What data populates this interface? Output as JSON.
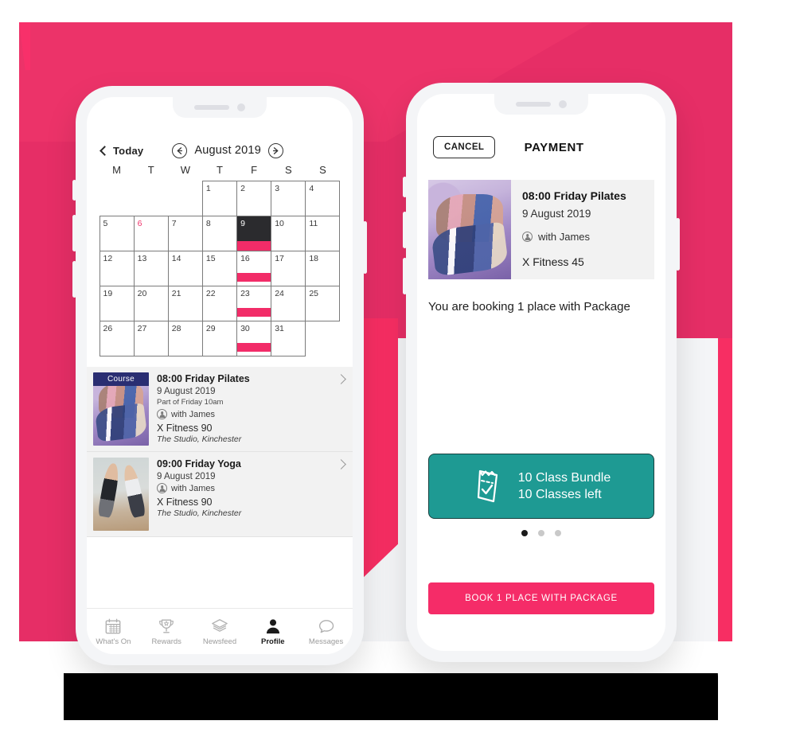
{
  "colors": {
    "pink": "#E62E66",
    "pink_bright": "#F72E63",
    "accent_pink": "#F22C68",
    "teal": "#1E9A93",
    "badge_navy": "#2A2E72",
    "selected_dark": "#2B2B2E"
  },
  "left_phone": {
    "header": {
      "back_label": "Today",
      "prev_icon": "arrow-left-circle-icon",
      "month_label": "August 2019",
      "next_icon": "arrow-right-circle-icon"
    },
    "calendar": {
      "day_headers": [
        "M",
        "T",
        "W",
        "T",
        "F",
        "S",
        "S"
      ],
      "leading_blanks": 3,
      "days": [
        {
          "n": 1
        },
        {
          "n": 2
        },
        {
          "n": 3
        },
        {
          "n": 4
        },
        {
          "n": 5
        },
        {
          "n": 6,
          "today": true
        },
        {
          "n": 7
        },
        {
          "n": 8
        },
        {
          "n": 9,
          "selected": true,
          "event": true
        },
        {
          "n": 10
        },
        {
          "n": 11
        },
        {
          "n": 12
        },
        {
          "n": 13
        },
        {
          "n": 14
        },
        {
          "n": 15
        },
        {
          "n": 16,
          "event": true
        },
        {
          "n": 17
        },
        {
          "n": 18
        },
        {
          "n": 19
        },
        {
          "n": 20
        },
        {
          "n": 21
        },
        {
          "n": 22
        },
        {
          "n": 23,
          "event": true
        },
        {
          "n": 24
        },
        {
          "n": 25
        },
        {
          "n": 26
        },
        {
          "n": 27
        },
        {
          "n": 28
        },
        {
          "n": 29
        },
        {
          "n": 30,
          "event": true
        },
        {
          "n": 31
        }
      ]
    },
    "events": [
      {
        "badge": "Course",
        "title": "08:00 Friday Pilates",
        "date": "9 August 2019",
        "part_of": "Part of Friday 10am",
        "with": "with James",
        "fitness": "X Fitness 90",
        "location": "The Studio, Kinchester",
        "thumb": "pilates-photo"
      },
      {
        "badge": "",
        "title": "09:00 Friday Yoga",
        "date": "9 August 2019",
        "part_of": "",
        "with": "with James",
        "fitness": "X Fitness 90",
        "location": "The Studio, Kinchester",
        "thumb": "yoga-photo"
      }
    ],
    "bottom_nav": [
      {
        "label": "What's On",
        "icon": "calendar-icon",
        "active": false
      },
      {
        "label": "Rewards",
        "icon": "trophy-icon",
        "active": false
      },
      {
        "label": "Newsfeed",
        "icon": "layers-icon",
        "active": false
      },
      {
        "label": "Profile",
        "icon": "person-icon",
        "active": true
      },
      {
        "label": "Messages",
        "icon": "speech-bubble-icon",
        "active": false
      }
    ]
  },
  "right_phone": {
    "header": {
      "cancel_label": "CANCEL",
      "title": "PAYMENT"
    },
    "booking": {
      "title": "08:00 Friday Pilates",
      "date": "9 August 2019",
      "with": "with James",
      "fitness": "X Fitness 45",
      "thumb": "pilates-photo"
    },
    "note": "You are booking 1 place with Package",
    "package": {
      "icon": "ticket-check-icon",
      "line1": "10 Class Bundle",
      "line2": "10 Classes left"
    },
    "carousel": {
      "count": 3,
      "active_index": 0
    },
    "book_button": "BOOK 1 PLACE WITH PACKAGE"
  }
}
